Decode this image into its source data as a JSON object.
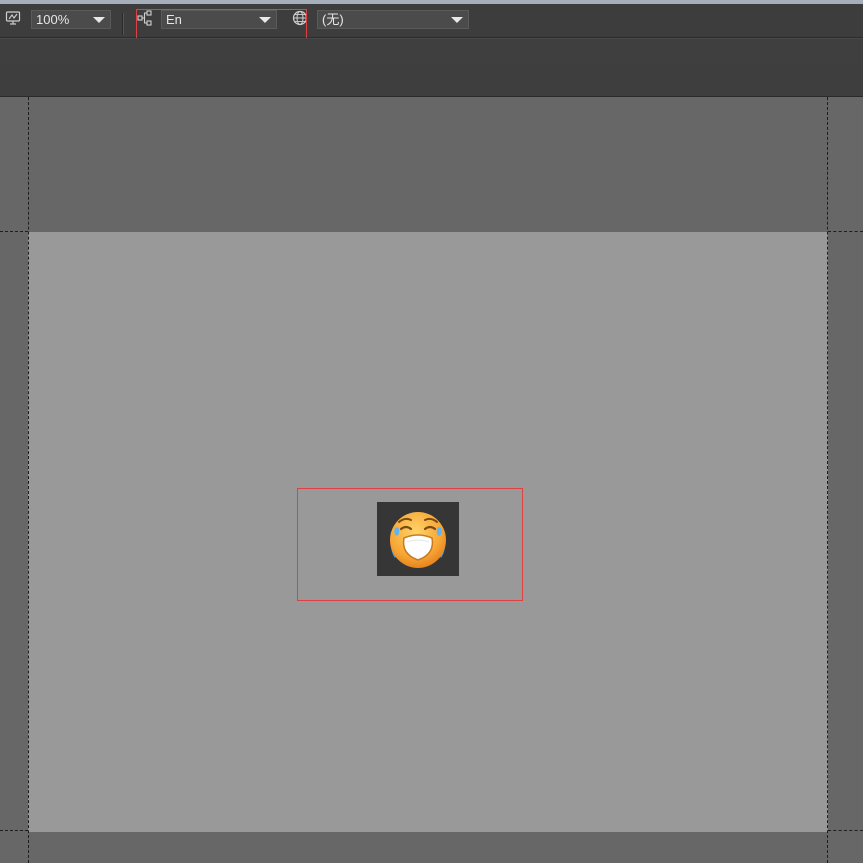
{
  "toolbar": {
    "zoom": {
      "value": "100%",
      "icon": "display-zoom-icon"
    },
    "language": {
      "value": "En",
      "icon": "hierarchy-tree-icon"
    },
    "locale": {
      "value": "(无)",
      "icon": "globe-icon"
    }
  },
  "canvas": {
    "image": {
      "icon": "crying-face-icon",
      "description_color": "#f7a736"
    }
  },
  "colors": {
    "toolbar_bg": "#3d3d3d",
    "workspace_bg": "#676767",
    "canvas_bg": "#999999",
    "highlight": "#e0403f"
  }
}
